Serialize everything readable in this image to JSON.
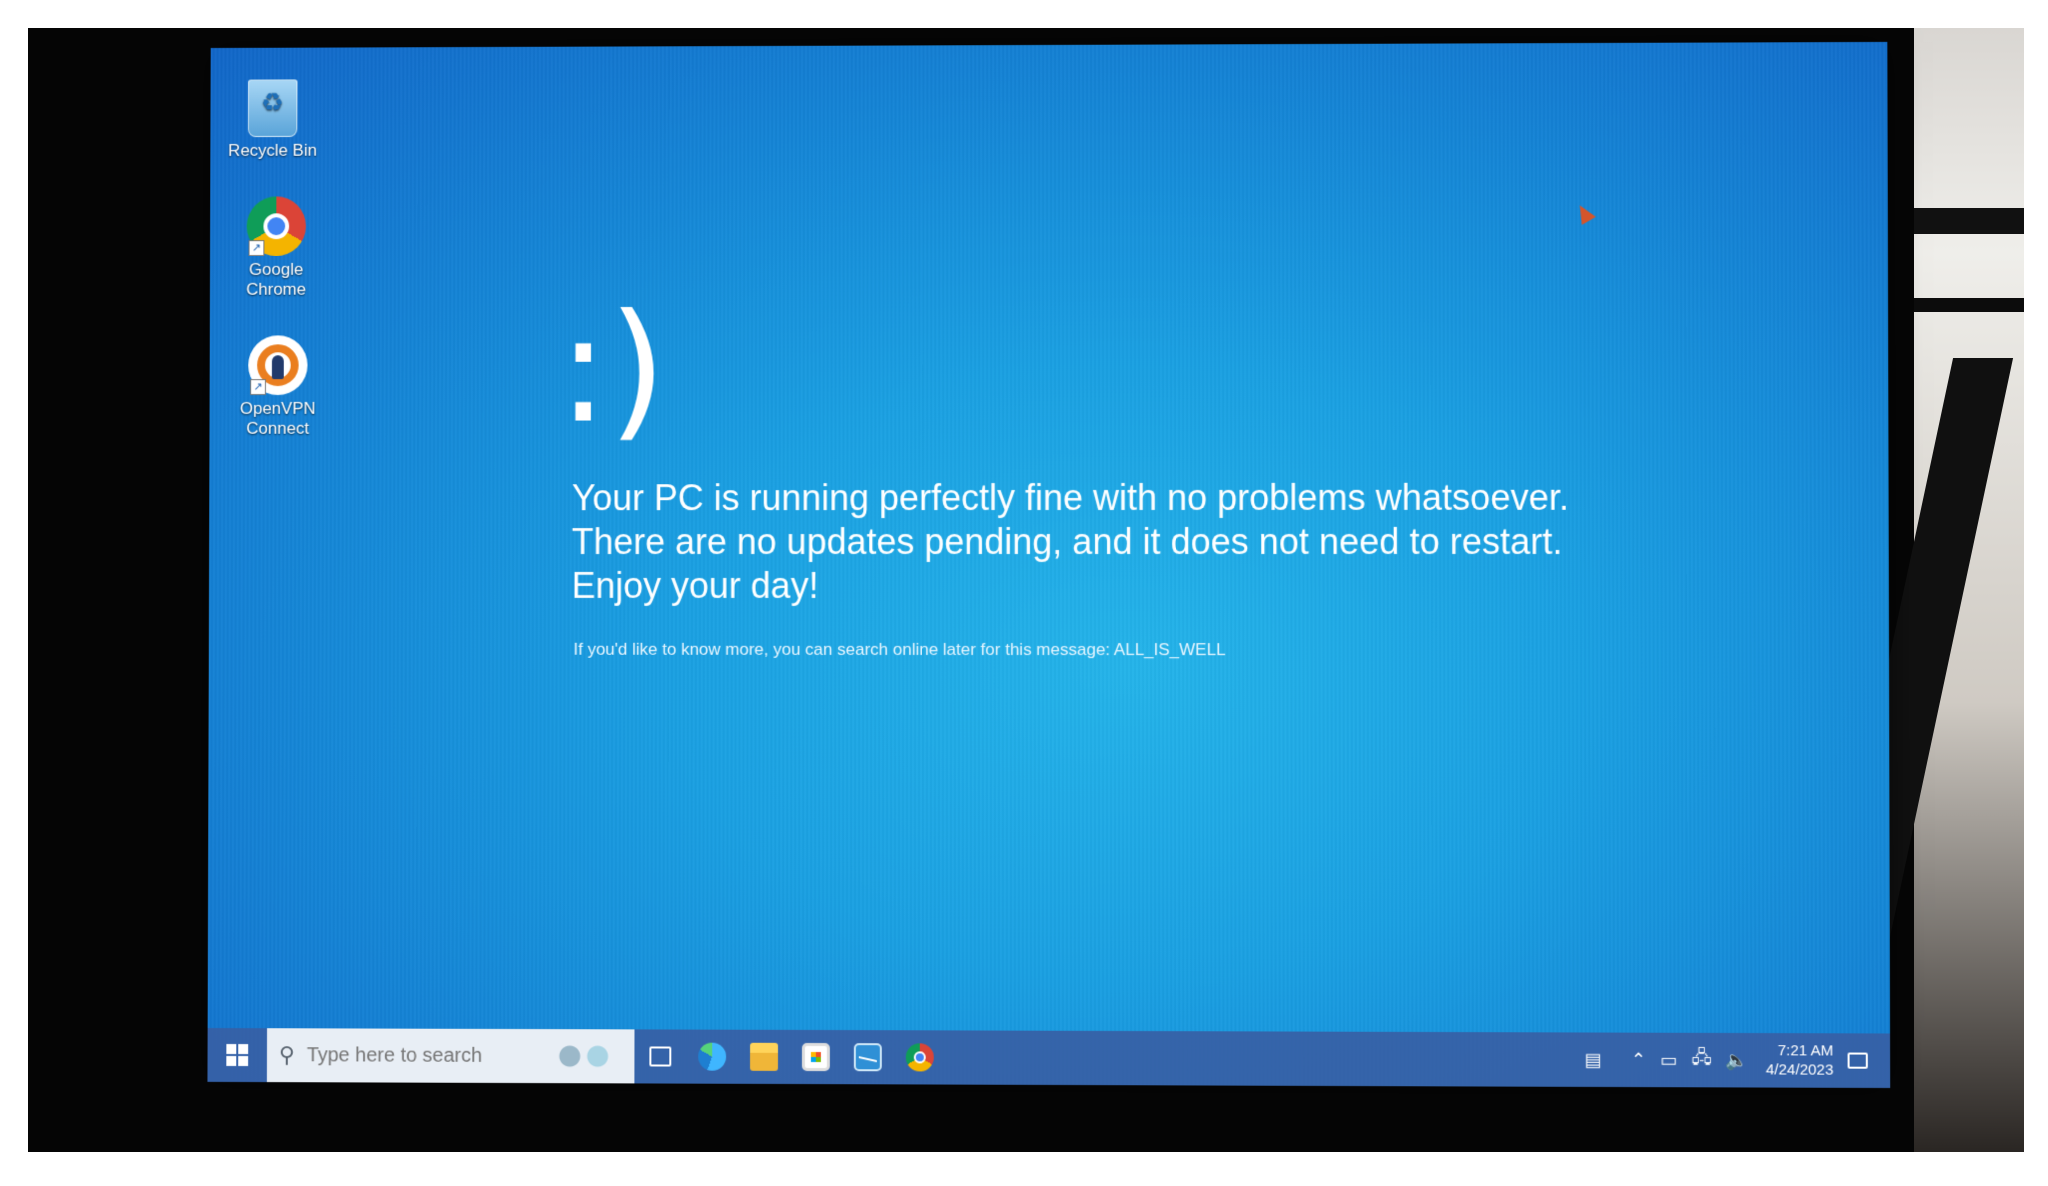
{
  "desktop": {
    "icons": [
      {
        "label": "Recycle Bin",
        "icon": "recycle-bin-icon"
      },
      {
        "label_line1": "Google",
        "label_line2": "Chrome",
        "icon": "chrome-icon"
      },
      {
        "label_line1": "OpenVPN",
        "label_line2": "Connect",
        "icon": "openvpn-icon"
      }
    ]
  },
  "screen": {
    "face": ":)",
    "message_lines": [
      "Your PC is running perfectly fine with no problems whatsoever.",
      "There are no updates pending, and it does not need to restart.",
      "Enjoy your day!"
    ],
    "hint": "If you'd like to know more, you can search online later for this message: ALL_IS_WELL"
  },
  "taskbar": {
    "search_placeholder": "Type here to search",
    "apps": [
      "task-view-icon",
      "edge-icon",
      "file-explorer-icon",
      "store-icon",
      "mail-icon",
      "chrome-icon"
    ],
    "clock_time": "7:21 AM",
    "clock_date": "4/24/2023"
  },
  "colors": {
    "bsod_blue": "#1aa0e2",
    "taskbar": "#375fa5"
  }
}
